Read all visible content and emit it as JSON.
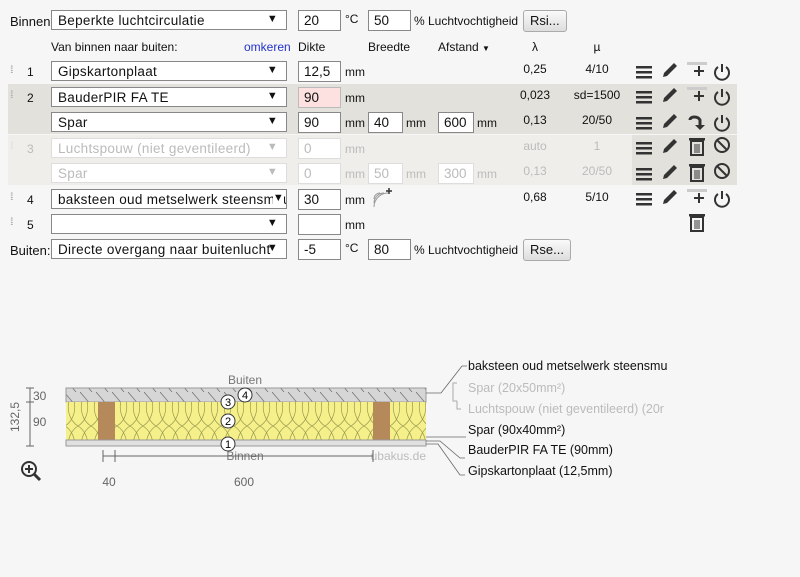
{
  "inside": {
    "label": "Binnen:",
    "select": "Beperkte luchtcirculatie",
    "temp": "20",
    "temp_unit": "°C",
    "rh": "50",
    "rh_label": "% Luchtvochtigheid",
    "button": "Rsi..."
  },
  "header": {
    "direction": "Van binnen naar buiten:",
    "reverse_link": "omkeren",
    "thickness": "Dikte",
    "width": "Breedte",
    "spacing": "Afstand",
    "lambda": "λ",
    "mu": "µ"
  },
  "unit": "mm",
  "layers": [
    {
      "num": "1",
      "material": "Gipskartonplaat",
      "thickness": "12,5",
      "lambda": "0,25",
      "mu": "4/10"
    },
    {
      "num": "2",
      "material": "BauderPIR FA TE",
      "thickness": "90",
      "lambda": "0,023",
      "mu": "sd=1500",
      "sub": {
        "material": "Spar",
        "thickness": "90",
        "width": "40",
        "spacing": "600",
        "lambda": "0,13",
        "mu": "20/50"
      }
    },
    {
      "num": "3",
      "material": "Luchtspouw (niet geventileerd)",
      "thickness": "0",
      "lambda": "auto",
      "mu": "1",
      "disabled": true,
      "sub": {
        "material": "Spar",
        "thickness": "0",
        "width": "50",
        "spacing": "300",
        "lambda": "0,13",
        "mu": "20/50"
      }
    },
    {
      "num": "4",
      "material": "baksteen oud metselwerk steensmuu",
      "thickness": "30",
      "lambda": "0,68",
      "mu": "5/10"
    },
    {
      "num": "5",
      "material": "",
      "thickness": ""
    }
  ],
  "outside": {
    "label": "Buiten:",
    "select": "Directe overgang naar buitenlucht",
    "temp": "-5",
    "temp_unit": "°C",
    "rh": "80",
    "rh_label": "% Luchtvochtigheid",
    "button": "Rse..."
  },
  "diagram": {
    "top": "Buiten",
    "bottom": "Binnen",
    "watermark": "ubakus.de",
    "dims": {
      "total": "132,5",
      "d1": "30",
      "d2": "90",
      "w1": "40",
      "w2": "600"
    },
    "markers": [
      "1",
      "2",
      "3",
      "4"
    ],
    "legend": [
      "baksteen oud metselwerk steensmu",
      "Spar (20x50mm²)",
      "Luchtspouw (niet geventileerd) (20r",
      "Spar (90x40mm²)",
      "BauderPIR FA TE (90mm)",
      "Gipskartonplaat (12,5mm)"
    ]
  },
  "colors": {
    "insulation": "#f5f08a",
    "wood": "#b5895a",
    "brick": "#d8d8d8",
    "row_active": "#e2e1dc",
    "link": "#2233cc",
    "error_input": "#fde0e0"
  }
}
